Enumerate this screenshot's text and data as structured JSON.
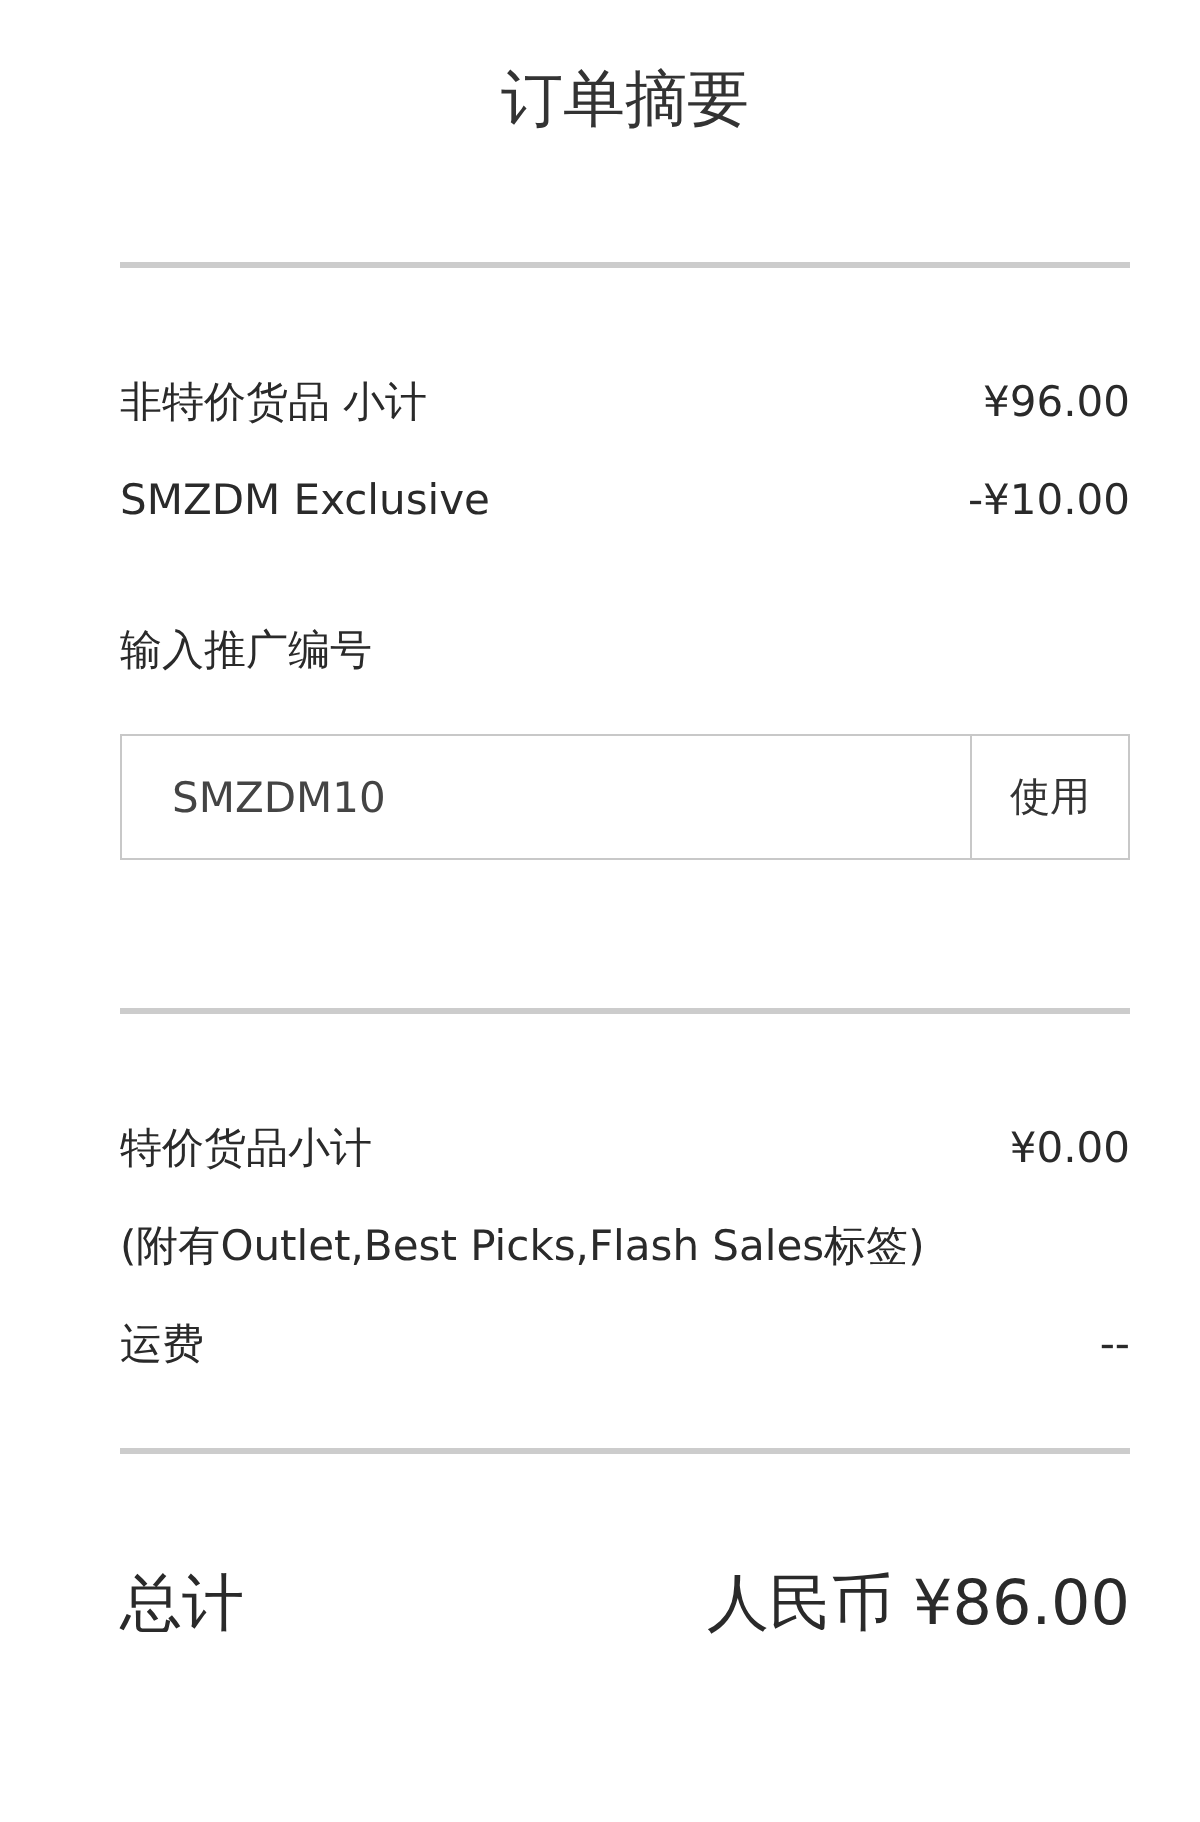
{
  "title": "订单摘要",
  "summary_lines": [
    {
      "label": "非特价货品 小计",
      "amount": "¥96.00"
    },
    {
      "label": "SMZDM Exclusive",
      "amount": "-¥10.00"
    }
  ],
  "promo": {
    "label": "输入推广编号",
    "value": "SMZDM10",
    "button": "使用"
  },
  "sale_lines": [
    {
      "label": "特价货品小计",
      "amount": "¥0.00"
    },
    {
      "label": "(附有Outlet,Best Picks,Flash Sales标签)"
    },
    {
      "label": "运费",
      "amount": "--"
    }
  ],
  "total": {
    "label": "总计",
    "amount": "人民币 ¥86.00"
  }
}
